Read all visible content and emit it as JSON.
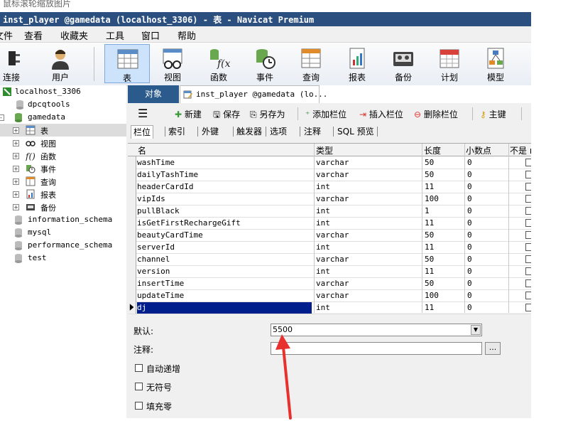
{
  "caption": "鼠标滚轮缩放图片",
  "window": {
    "title": "inst_player @gamedata (localhost_3306) - 表 - Navicat Premium"
  },
  "menu": [
    "查看",
    "收藏夹",
    "工具",
    "窗口",
    "帮助"
  ],
  "menu_stub": "文件",
  "toolbar": [
    {
      "label": "连接",
      "icon": "connect-icon"
    },
    {
      "label": "用户",
      "icon": "user-icon"
    },
    {
      "label": "表",
      "icon": "table-icon"
    },
    {
      "label": "视图",
      "icon": "view-icon"
    },
    {
      "label": "函数",
      "icon": "function-icon"
    },
    {
      "label": "事件",
      "icon": "event-icon"
    },
    {
      "label": "查询",
      "icon": "query-icon"
    },
    {
      "label": "报表",
      "icon": "report-icon"
    },
    {
      "label": "备份",
      "icon": "backup-icon"
    },
    {
      "label": "计划",
      "icon": "schedule-icon"
    },
    {
      "label": "模型",
      "icon": "model-icon"
    }
  ],
  "tree": {
    "connection": "localhost_3306",
    "databases_before": [
      "dpcqtools"
    ],
    "current_db": "gamedata",
    "children": [
      "表",
      "视图",
      "函数",
      "事件",
      "查询",
      "报表",
      "备份"
    ],
    "databases_after": [
      "information_schema",
      "mysql",
      "performance_schema",
      "test"
    ]
  },
  "tabs": {
    "objects": "对象",
    "document": "inst_player @gamedata (lo..."
  },
  "obj_toolbar": {
    "new": "新建",
    "save": "保存",
    "save_as": "另存为",
    "add_field": "添加栏位",
    "insert_field": "插入栏位",
    "delete_field": "删除栏位",
    "primary_key": "主键"
  },
  "subtabs": [
    "栏位",
    "索引",
    "外键",
    "触发器",
    "选项",
    "注释",
    "SQL 预览"
  ],
  "grid": {
    "headers": [
      "名",
      "类型",
      "长度",
      "小数点",
      "不是 null"
    ],
    "rows": [
      [
        "washTime",
        "varchar",
        "50",
        "0"
      ],
      [
        "dailyTashTime",
        "varchar",
        "50",
        "0"
      ],
      [
        "headerCardId",
        "int",
        "11",
        "0"
      ],
      [
        "vipIds",
        "varchar",
        "100",
        "0"
      ],
      [
        "pullBlack",
        "int",
        "1",
        "0"
      ],
      [
        "isGetFirstRechargeGift",
        "int",
        "11",
        "0"
      ],
      [
        "beautyCardTime",
        "varchar",
        "50",
        "0"
      ],
      [
        "serverId",
        "int",
        "11",
        "0"
      ],
      [
        "channel",
        "varchar",
        "50",
        "0"
      ],
      [
        "version",
        "int",
        "11",
        "0"
      ],
      [
        "insertTime",
        "varchar",
        "50",
        "0"
      ],
      [
        "updateTime",
        "varchar",
        "100",
        "0"
      ],
      [
        "dj",
        "int",
        "11",
        "0"
      ]
    ]
  },
  "props": {
    "default_label": "默认:",
    "default_value": "5500",
    "comment_label": "注释:",
    "comment_value": "",
    "browse_label": "...",
    "auto_increment": "自动递增",
    "unsigned": "无符号",
    "zerofill": "填充零"
  },
  "colors": {
    "arrow": "#e8312f",
    "title_bar": "#2b4f7e",
    "selection": "#001f8c"
  }
}
